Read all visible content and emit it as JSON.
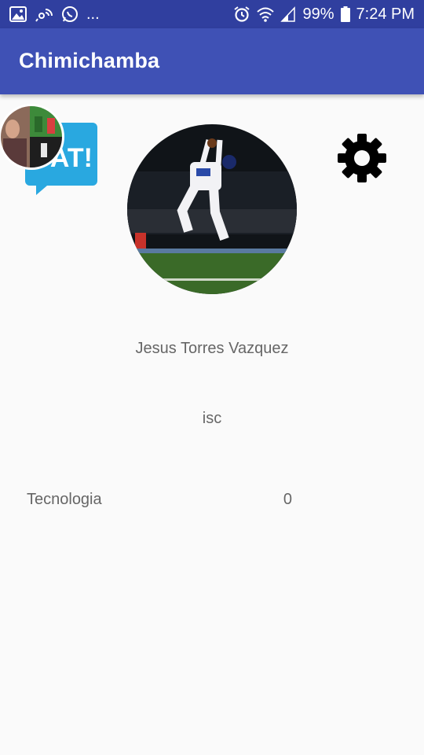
{
  "status_bar": {
    "more_label": "...",
    "battery": "99%",
    "time": "7:24 PM",
    "icons": [
      "image-icon",
      "broadcast-icon",
      "whatsapp-icon",
      "alarm-icon",
      "wifi-icon",
      "signal-icon",
      "battery-icon"
    ]
  },
  "app_bar": {
    "title": "Chimichamba",
    "color": "#3f51b5",
    "status_color": "#303f9f"
  },
  "chat_head": {
    "badge_text": "AT!",
    "badge_color": "#29a8e0"
  },
  "profile": {
    "name": "Jesus Torres Vazquez",
    "career": "isc",
    "photo_icon": "profile-photo"
  },
  "categories": [
    {
      "label": "Tecnologia",
      "count": "0"
    }
  ],
  "settings": {
    "icon": "gear-icon"
  }
}
